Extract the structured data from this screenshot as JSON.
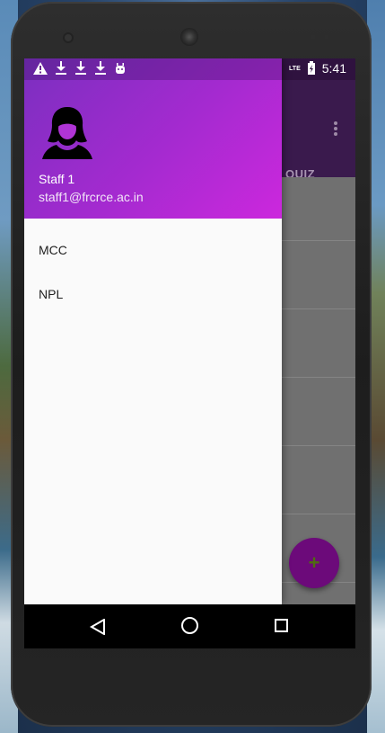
{
  "status_bar": {
    "time": "5:41",
    "network": "LTE",
    "left_icons": [
      "warning-icon",
      "download-icon",
      "download-icon",
      "download-icon",
      "android-icon"
    ]
  },
  "app": {
    "tab_label": "QUIZ",
    "fab_label": "+"
  },
  "drawer": {
    "user_name": "Staff 1",
    "user_email": "staff1@frcrce.ac.in",
    "items": [
      {
        "label": "MCC"
      },
      {
        "label": "NPL"
      }
    ]
  },
  "colors": {
    "drawer_header_start": "#7b2fc0",
    "drawer_header_end": "#cc28dd",
    "fab": "#6c0a7a"
  }
}
